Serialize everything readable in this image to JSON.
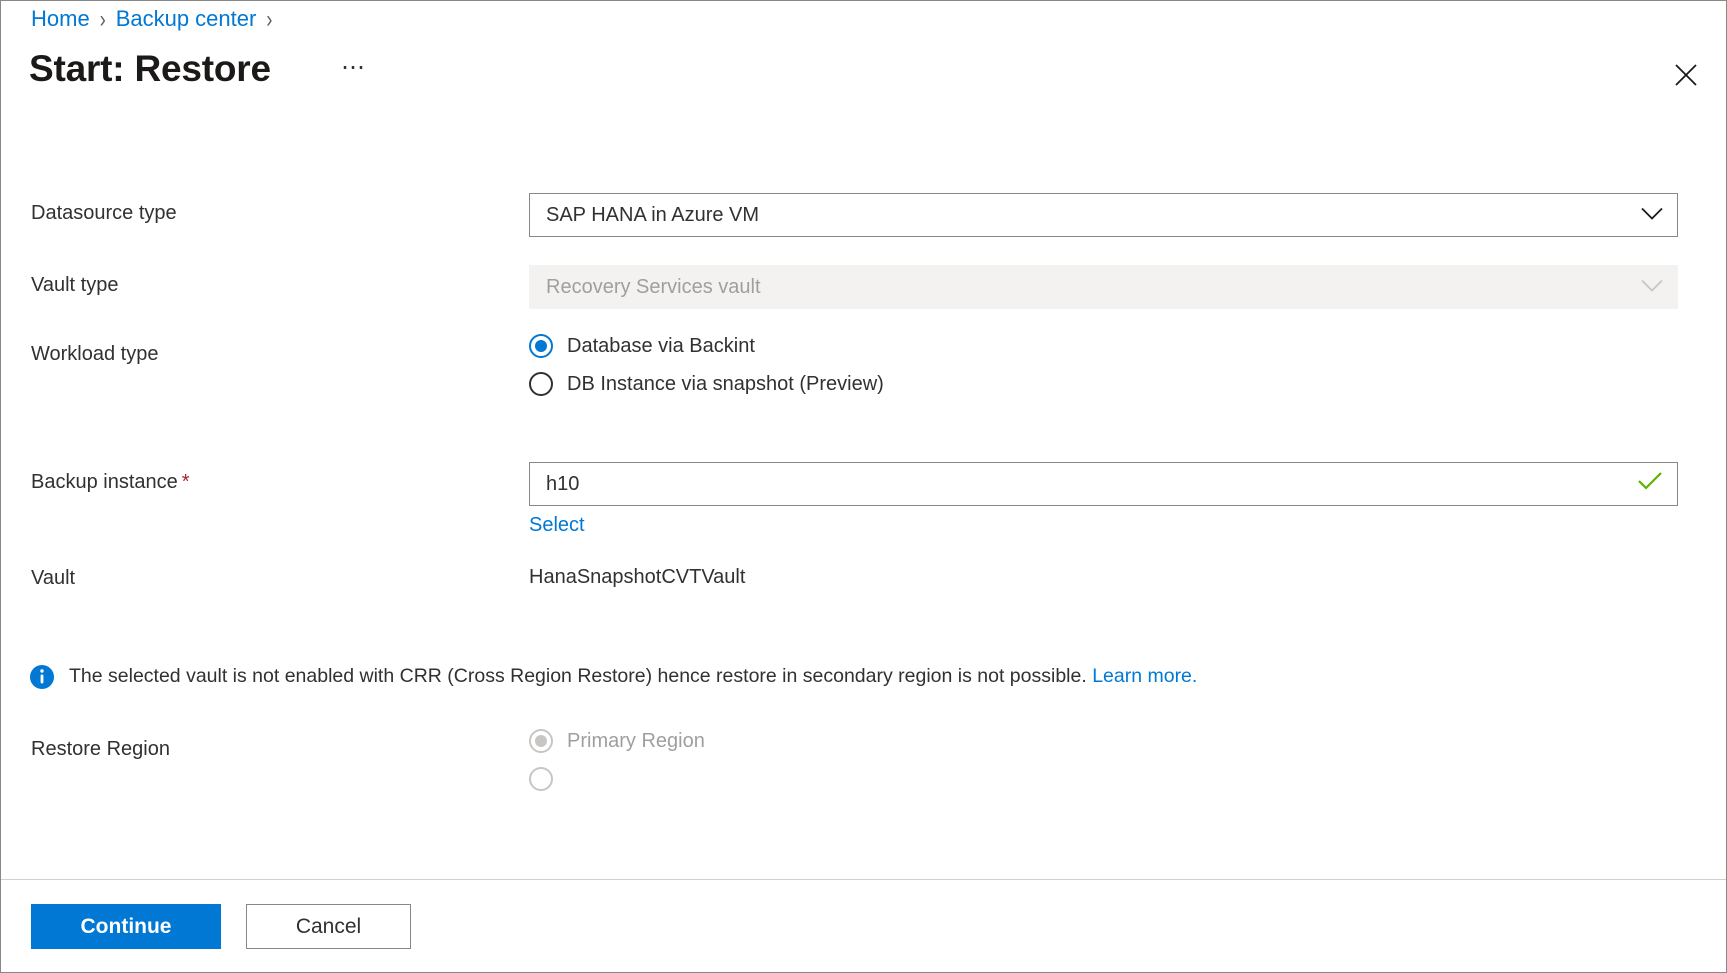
{
  "breadcrumb": {
    "items": [
      {
        "label": "Home"
      },
      {
        "label": "Backup center"
      }
    ],
    "separator": "›"
  },
  "header": {
    "title": "Start: Restore",
    "more_label": "⋯",
    "close_label": "Close"
  },
  "form": {
    "datasource_type": {
      "label": "Datasource type",
      "value": "SAP HANA in Azure VM",
      "icon": "chevron-down-icon"
    },
    "vault_type": {
      "label": "Vault type",
      "value": "Recovery Services vault",
      "disabled": true,
      "icon": "chevron-down-icon"
    },
    "workload_type": {
      "label": "Workload type",
      "options": [
        {
          "label": "Database via Backint",
          "checked": true,
          "disabled": false
        },
        {
          "label": "DB Instance via snapshot (Preview)",
          "checked": false,
          "disabled": false
        }
      ]
    },
    "backup_instance": {
      "label": "Backup instance",
      "required_marker": "*",
      "value": "h10",
      "placeholder": "",
      "select_link": "Select",
      "valid_icon": "check-icon",
      "valid_color": "#5cb300"
    },
    "vault": {
      "label": "Vault",
      "value": "HanaSnapshotCVTVault"
    },
    "info_banner": {
      "icon": "info-icon",
      "icon_color": "#0078d4",
      "text": "The selected vault is not enabled with CRR (Cross Region Restore) hence restore in secondary region is not possible.",
      "link_label": "Learn more."
    },
    "restore_region": {
      "label": "Restore Region",
      "options": [
        {
          "label": "Primary Region",
          "checked": true,
          "disabled": true
        }
      ]
    }
  },
  "footer": {
    "continue_label": "Continue",
    "cancel_label": "Cancel"
  },
  "colors": {
    "accent": "#0078d4",
    "required": "#a4262c",
    "success": "#5cb300",
    "border": "#8a8886"
  }
}
